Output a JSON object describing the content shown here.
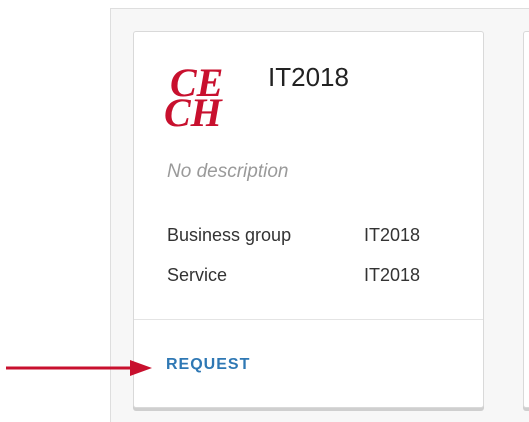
{
  "card": {
    "title": "IT2018",
    "logo_text": "CE CH",
    "description": "No description",
    "details": [
      {
        "label": "Business group",
        "value": "IT2018"
      },
      {
        "label": "Service",
        "value": "IT2018"
      }
    ],
    "request_label": "REQUEST"
  },
  "colors": {
    "logo": "#c8102e",
    "link": "#2f78b4",
    "arrow": "#c8102e"
  },
  "icons": {
    "logo": "cech-logo",
    "pointer": "red-arrow-icon"
  }
}
